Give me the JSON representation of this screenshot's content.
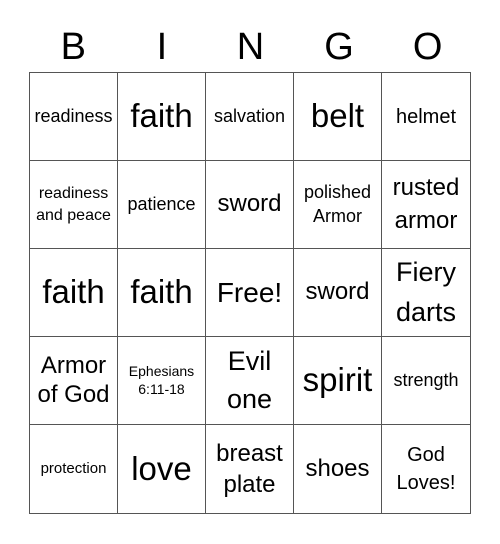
{
  "header": {
    "letters": [
      "B",
      "I",
      "N",
      "G",
      "O"
    ]
  },
  "cells": [
    "readiness",
    "faith",
    "salvation",
    "belt",
    "helmet",
    "readiness and peace",
    "patience",
    "sword",
    "polished Armor",
    "rusted armor",
    "faith",
    "faith",
    "Free!",
    "sword",
    "Fiery darts",
    "Armor of God",
    "Ephesians 6:11-18",
    "Evil one",
    "spirit",
    "strength",
    "protection",
    "love",
    "breast plate",
    "shoes",
    "God Loves!"
  ]
}
